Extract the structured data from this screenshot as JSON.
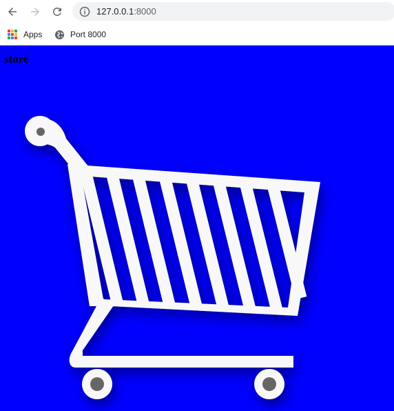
{
  "browser": {
    "url_host": "127.0.0.1",
    "url_port": ":8000",
    "icons": {
      "back": "arrow-left-icon",
      "forward": "arrow-right-icon",
      "reload": "reload-icon",
      "info": "info-icon"
    }
  },
  "bookmarks": [
    {
      "label": "Apps",
      "icon": "apps-grid-icon"
    },
    {
      "label": "Port 8000",
      "icon": "globe-icon"
    }
  ],
  "page": {
    "heading": "store",
    "background_color": "#0000ff",
    "cart_color": "#f8f8f8",
    "wheel_hub_color": "#666666",
    "cart_icon": "shopping-cart-icon"
  }
}
